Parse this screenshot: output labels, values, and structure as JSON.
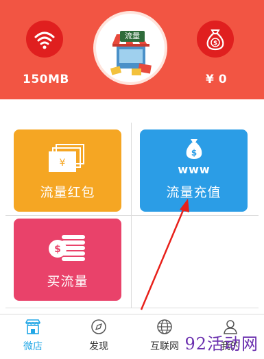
{
  "header": {
    "traffic_value": "150MB",
    "balance_value": "¥ 0",
    "store_sign": "流量",
    "colors": {
      "background": "#f25543",
      "icon_circle": "#e01f1f"
    },
    "icons": {
      "left": "wifi-icon",
      "center": "store-icon",
      "right": "money-bag-icon"
    }
  },
  "tiles": [
    {
      "label": "流量红包",
      "color": "#f5a623",
      "icon": "red-envelope-icon"
    },
    {
      "label": "流量充值",
      "color": "#2b9de6",
      "icon": "www-money-bag-icon"
    },
    {
      "label": "买流量",
      "color": "#e9426a",
      "icon": "coin-stack-icon"
    }
  ],
  "tabs": [
    {
      "label": "微店",
      "icon": "shop-icon",
      "active": true
    },
    {
      "label": "发现",
      "icon": "compass-icon",
      "active": false
    },
    {
      "label": "互联网",
      "icon": "globe-icon",
      "active": false
    },
    {
      "label": "我的",
      "icon": "user-icon",
      "active": false
    }
  ],
  "watermark": "92活动网",
  "accent_color": "#22a7e6"
}
